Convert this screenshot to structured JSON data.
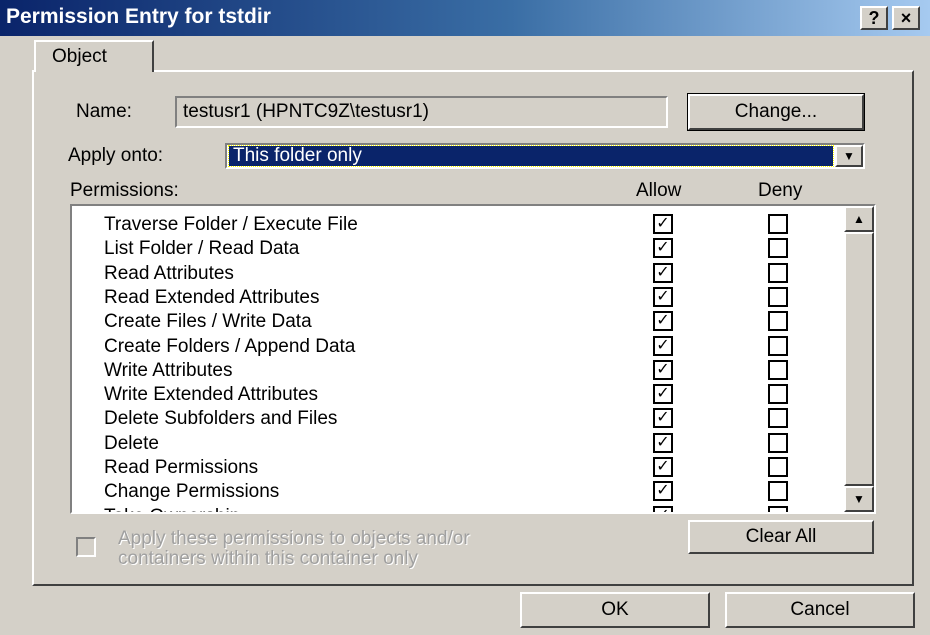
{
  "window": {
    "title": "Permission Entry for tstdir",
    "help_glyph": "?",
    "close_glyph": "×"
  },
  "tabs": [
    {
      "label": "Object"
    }
  ],
  "name_label": "Name:",
  "name_value": "testusr1 (HPNTC9Z\\testusr1)",
  "change_button": "Change...",
  "apply_onto": {
    "label": "Apply onto:",
    "value": "This folder only",
    "arrow_glyph": "▼"
  },
  "permissions": {
    "label": "Permissions:",
    "allow_header": "Allow",
    "deny_header": "Deny",
    "rows": [
      {
        "name": "Traverse Folder / Execute File",
        "allow": true,
        "deny": false
      },
      {
        "name": "List Folder / Read Data",
        "allow": true,
        "deny": false
      },
      {
        "name": "Read Attributes",
        "allow": true,
        "deny": false
      },
      {
        "name": "Read Extended Attributes",
        "allow": true,
        "deny": false
      },
      {
        "name": "Create Files / Write Data",
        "allow": true,
        "deny": false
      },
      {
        "name": "Create Folders / Append Data",
        "allow": true,
        "deny": false
      },
      {
        "name": "Write Attributes",
        "allow": true,
        "deny": false
      },
      {
        "name": "Write Extended Attributes",
        "allow": true,
        "deny": false
      },
      {
        "name": "Delete Subfolders and Files",
        "allow": true,
        "deny": false
      },
      {
        "name": "Delete",
        "allow": true,
        "deny": false
      },
      {
        "name": "Read Permissions",
        "allow": true,
        "deny": false
      },
      {
        "name": "Change Permissions",
        "allow": true,
        "deny": false
      },
      {
        "name": "Take Ownership",
        "allow": true,
        "deny": false
      }
    ],
    "check_glyph": "✓",
    "scroll_up_glyph": "▲",
    "scroll_down_glyph": "▼"
  },
  "apply_checkbox": {
    "line1": "Apply these permissions to objects and/or",
    "line2": "containers within this container only",
    "checked": false
  },
  "clear_all_button": "Clear All",
  "ok_button": "OK",
  "cancel_button": "Cancel"
}
